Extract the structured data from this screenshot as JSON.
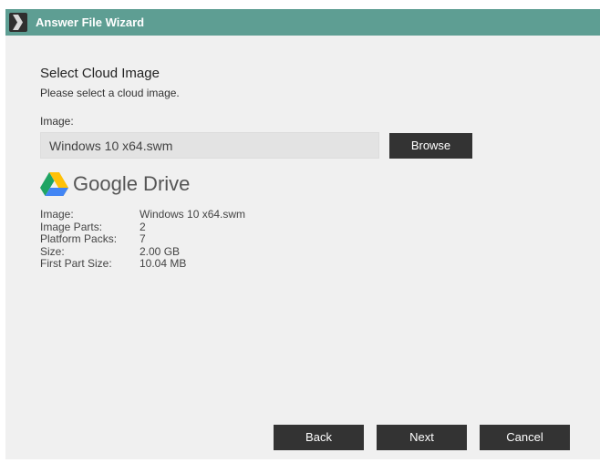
{
  "window": {
    "title": "Answer File Wizard"
  },
  "page": {
    "heading": "Select Cloud Image",
    "subheading": "Please select a cloud image."
  },
  "image_field": {
    "label": "Image:",
    "value": "Windows 10 x64.swm"
  },
  "buttons": {
    "browse": "Browse",
    "back": "Back",
    "next": "Next",
    "cancel": "Cancel"
  },
  "provider": {
    "name": "Google Drive",
    "icon": "google-drive-icon"
  },
  "details": [
    {
      "label": "Image:",
      "value": "Windows 10 x64.swm"
    },
    {
      "label": "Image Parts:",
      "value": "2"
    },
    {
      "label": "Platform Packs:",
      "value": "7"
    },
    {
      "label": "Size:",
      "value": "2.00 GB"
    },
    {
      "label": "First Part Size:",
      "value": "10.04 MB"
    }
  ],
  "colors": {
    "titlebar": "#5e9e93",
    "button": "#333333",
    "background": "#f0f0f0"
  }
}
